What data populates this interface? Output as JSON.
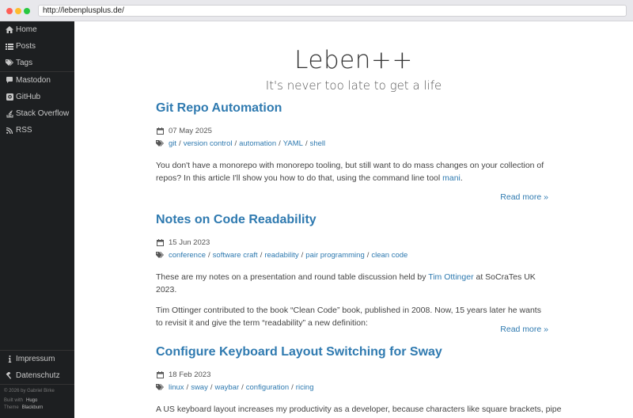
{
  "browser": {
    "url": "http://lebenplusplus.de/"
  },
  "sidebar": {
    "items": [
      {
        "label": "Home",
        "icon": "home-icon"
      },
      {
        "label": "Posts",
        "icon": "list-icon"
      },
      {
        "label": "Tags",
        "icon": "tags-icon"
      },
      {
        "label": "Mastodon",
        "icon": "mastodon-icon"
      },
      {
        "label": "GitHub",
        "icon": "github-icon"
      },
      {
        "label": "Stack Overflow",
        "icon": "stackoverflow-icon"
      },
      {
        "label": "RSS",
        "icon": "rss-icon"
      }
    ],
    "bottom": [
      {
        "label": "Impressum",
        "icon": "info-icon"
      },
      {
        "label": "Datenschutz",
        "icon": "gavel-icon"
      }
    ],
    "footer": {
      "copyright": "© 2026 by Gabriel Birke",
      "built_with": "Built with",
      "hugo": "Hugo",
      "theme": "Theme",
      "blackburn": "Blackburn"
    }
  },
  "header": {
    "title": "Leben++",
    "subtitle": "It's never too late to get a life"
  },
  "posts": [
    {
      "title": "Git Repo Automation",
      "date": "07 May 2025",
      "tags": [
        "git",
        "version control",
        "automation",
        "YAML",
        "shell"
      ],
      "p1_before": "You don't have a monorepo with monorepo tooling, but still want to do mass changes on your collection of repos? In this article I'll show you how to do that, using the command line tool ",
      "p1_link": "mani",
      "p1_after": ".",
      "read_more": "Read more »"
    },
    {
      "title": "Notes on Code Readability",
      "date": "15 Jun 2023",
      "tags": [
        "conference",
        "software craft",
        "readability",
        "pair programming",
        "clean code"
      ],
      "p1_before": "These are my notes on a presentation and round table discussion held by ",
      "p1_link": "Tim Ottinger",
      "p1_after": " at SoCraTes UK 2023.",
      "p2": "Tim Ottinger contributed to the book “Clean Code” book, published in 2008. Now, 15 years later he wants to revisit it and give the term “readability” a new definition:",
      "read_more": "Read more »"
    },
    {
      "title": "Configure Keyboard Layout Switching for Sway",
      "date": "18 Feb 2023",
      "tags": [
        "linux",
        "sway",
        "waybar",
        "configuration",
        "ricing"
      ],
      "p1": "A US keyboard layout increases my productivity as a developer, because characters like square brackets, pipe"
    }
  ]
}
